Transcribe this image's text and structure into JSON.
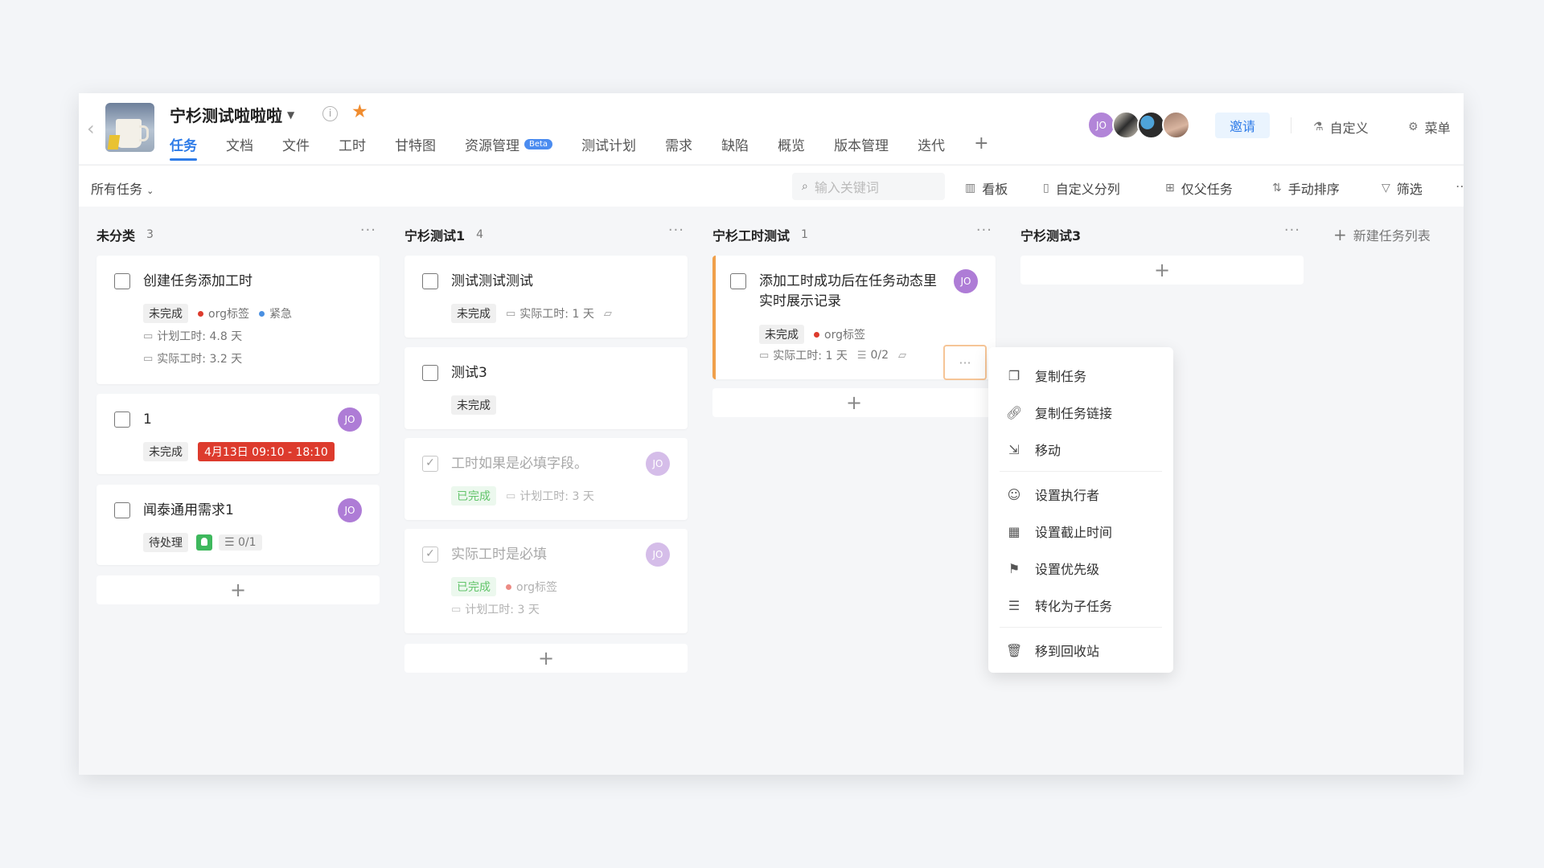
{
  "header": {
    "project_title": "宁杉测试啦啦啦",
    "tabs": [
      {
        "label": "任务",
        "active": true
      },
      {
        "label": "文档"
      },
      {
        "label": "文件"
      },
      {
        "label": "工时"
      },
      {
        "label": "甘特图"
      },
      {
        "label": "资源管理",
        "badge": "Beta"
      },
      {
        "label": "测试计划"
      },
      {
        "label": "需求"
      },
      {
        "label": "缺陷"
      },
      {
        "label": "概览"
      },
      {
        "label": "版本管理"
      },
      {
        "label": "迭代"
      }
    ],
    "add_tab": "+",
    "avatar_initials": "JO",
    "invite_label": "邀请",
    "customize_label": "自定义",
    "menu_label": "菜单",
    "accent_color": "#2f7ce8"
  },
  "toolbar": {
    "filter_label": "所有任务",
    "search_placeholder": "输入关键词",
    "board_label": "看板",
    "custom_columns_label": "自定义分列",
    "parent_only_label": "仅父任务",
    "sort_label": "手动排序",
    "filter_btn_label": "筛选"
  },
  "columns": [
    {
      "title": "未分类",
      "count": "3",
      "cards": [
        {
          "title": "创建任务添加工时",
          "status": "未完成",
          "tag1": "org标签",
          "tag2": "紧急",
          "plan": "计划工时: 4.8 天",
          "actual": "实际工时: 3.2 天"
        },
        {
          "title": "1",
          "status": "未完成",
          "time": "4月13日 09:10 - 18:10",
          "avatar": "JO"
        },
        {
          "title": "闻泰通用需求1",
          "status": "待处理",
          "subtasks": "0/1",
          "avatar": "JO"
        }
      ]
    },
    {
      "title": "宁杉测试1",
      "count": "4",
      "cards": [
        {
          "title": "测试测试测试",
          "status": "未完成",
          "actual": "实际工时: 1 天"
        },
        {
          "title": "测试3",
          "status": "未完成"
        },
        {
          "title": "工时如果是必填字段。",
          "status": "已完成",
          "plan": "计划工时: 3 天",
          "avatar": "JO"
        },
        {
          "title": "实际工时是必填",
          "status": "已完成",
          "tag1": "org标签",
          "plan": "计划工时: 3 天",
          "avatar": "JO"
        }
      ]
    },
    {
      "title": "宁杉工时测试",
      "count": "1",
      "cards": [
        {
          "title": "添加工时成功后在任务动态里实时展示记录",
          "status": "未完成",
          "tag1": "org标签",
          "actual": "实际工时: 1 天",
          "subtasks": "0/2",
          "avatar": "JO"
        }
      ]
    },
    {
      "title": "宁杉测试3",
      "count": "",
      "cards": []
    }
  ],
  "new_list_label": "新建任务列表",
  "context_menu": [
    {
      "label": "复制任务",
      "icon": "copy-icon"
    },
    {
      "label": "复制任务链接",
      "icon": "link-icon"
    },
    {
      "label": "移动",
      "icon": "move-icon"
    },
    {
      "label": "设置执行者",
      "icon": "user-icon"
    },
    {
      "label": "设置截止时间",
      "icon": "calendar-icon"
    },
    {
      "label": "设置优先级",
      "icon": "flag-icon"
    },
    {
      "label": "转化为子任务",
      "icon": "subtask-icon"
    },
    {
      "label": "移到回收站",
      "icon": "trash-icon"
    }
  ],
  "colors": {
    "urgent_overdue": "#dd3b2d",
    "highlight_border": "#f6c597",
    "done_green": "#62c46a",
    "column_accent_orange": "#f0a04b"
  }
}
